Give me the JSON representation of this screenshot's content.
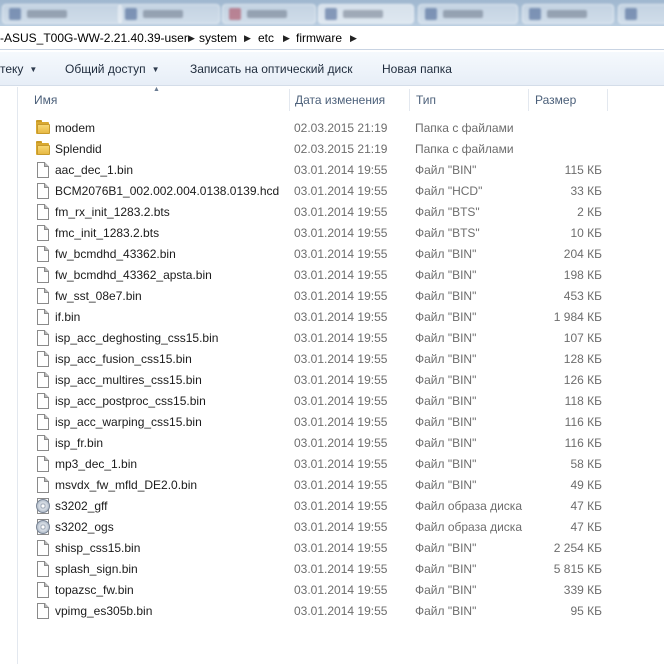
{
  "window": {
    "address": {
      "segments": [
        "-ASUS_T00G-WW-2.21.40.39-user",
        "system",
        "etc",
        "firmware"
      ]
    },
    "toolbar": {
      "organize_label": "теку",
      "share_label": "Общий доступ",
      "burn_label": "Записать на оптический диск",
      "new_folder_label": "Новая папка"
    },
    "columns": {
      "name": "Имя",
      "date": "Дата изменения",
      "type": "Тип",
      "size": "Размер"
    },
    "files": [
      {
        "name": "modem",
        "date": "02.03.2015 21:19",
        "type": "Папка с файлами",
        "size": "",
        "icon": "folder-icon"
      },
      {
        "name": "Splendid",
        "date": "02.03.2015 21:19",
        "type": "Папка с файлами",
        "size": "",
        "icon": "folder-icon"
      },
      {
        "name": "aac_dec_1.bin",
        "date": "03.01.2014 19:55",
        "type": "Файл \"BIN\"",
        "size": "115 КБ",
        "icon": "file-icon"
      },
      {
        "name": "BCM2076B1_002.002.004.0138.0139.hcd",
        "date": "03.01.2014 19:55",
        "type": "Файл \"HCD\"",
        "size": "33 КБ",
        "icon": "file-icon"
      },
      {
        "name": "fm_rx_init_1283.2.bts",
        "date": "03.01.2014 19:55",
        "type": "Файл \"BTS\"",
        "size": "2 КБ",
        "icon": "file-icon"
      },
      {
        "name": "fmc_init_1283.2.bts",
        "date": "03.01.2014 19:55",
        "type": "Файл \"BTS\"",
        "size": "10 КБ",
        "icon": "file-icon"
      },
      {
        "name": "fw_bcmdhd_43362.bin",
        "date": "03.01.2014 19:55",
        "type": "Файл \"BIN\"",
        "size": "204 КБ",
        "icon": "file-icon"
      },
      {
        "name": "fw_bcmdhd_43362_apsta.bin",
        "date": "03.01.2014 19:55",
        "type": "Файл \"BIN\"",
        "size": "198 КБ",
        "icon": "file-icon"
      },
      {
        "name": "fw_sst_08e7.bin",
        "date": "03.01.2014 19:55",
        "type": "Файл \"BIN\"",
        "size": "453 КБ",
        "icon": "file-icon"
      },
      {
        "name": "if.bin",
        "date": "03.01.2014 19:55",
        "type": "Файл \"BIN\"",
        "size": "1 984 КБ",
        "icon": "file-icon"
      },
      {
        "name": "isp_acc_deghosting_css15.bin",
        "date": "03.01.2014 19:55",
        "type": "Файл \"BIN\"",
        "size": "107 КБ",
        "icon": "file-icon"
      },
      {
        "name": "isp_acc_fusion_css15.bin",
        "date": "03.01.2014 19:55",
        "type": "Файл \"BIN\"",
        "size": "128 КБ",
        "icon": "file-icon"
      },
      {
        "name": "isp_acc_multires_css15.bin",
        "date": "03.01.2014 19:55",
        "type": "Файл \"BIN\"",
        "size": "126 КБ",
        "icon": "file-icon"
      },
      {
        "name": "isp_acc_postproc_css15.bin",
        "date": "03.01.2014 19:55",
        "type": "Файл \"BIN\"",
        "size": "118 КБ",
        "icon": "file-icon"
      },
      {
        "name": "isp_acc_warping_css15.bin",
        "date": "03.01.2014 19:55",
        "type": "Файл \"BIN\"",
        "size": "116 КБ",
        "icon": "file-icon"
      },
      {
        "name": "isp_fr.bin",
        "date": "03.01.2014 19:55",
        "type": "Файл \"BIN\"",
        "size": "116 КБ",
        "icon": "file-icon"
      },
      {
        "name": "mp3_dec_1.bin",
        "date": "03.01.2014 19:55",
        "type": "Файл \"BIN\"",
        "size": "58 КБ",
        "icon": "file-icon"
      },
      {
        "name": "msvdx_fw_mfld_DE2.0.bin",
        "date": "03.01.2014 19:55",
        "type": "Файл \"BIN\"",
        "size": "49 КБ",
        "icon": "file-icon"
      },
      {
        "name": "s3202_gff",
        "date": "03.01.2014 19:55",
        "type": "Файл образа диска",
        "size": "47 КБ",
        "icon": "disc-icon"
      },
      {
        "name": "s3202_ogs",
        "date": "03.01.2014 19:55",
        "type": "Файл образа диска",
        "size": "47 КБ",
        "icon": "disc-icon"
      },
      {
        "name": "shisp_css15.bin",
        "date": "03.01.2014 19:55",
        "type": "Файл \"BIN\"",
        "size": "2 254 КБ",
        "icon": "file-icon"
      },
      {
        "name": "splash_sign.bin",
        "date": "03.01.2014 19:55",
        "type": "Файл \"BIN\"",
        "size": "5 815 КБ",
        "icon": "file-icon"
      },
      {
        "name": "topazsc_fw.bin",
        "date": "03.01.2014 19:55",
        "type": "Файл \"BIN\"",
        "size": "339 КБ",
        "icon": "file-icon"
      },
      {
        "name": "vpimg_es305b.bin",
        "date": "03.01.2014 19:55",
        "type": "Файл \"BIN\"",
        "size": "95 КБ",
        "icon": "file-icon"
      }
    ]
  }
}
